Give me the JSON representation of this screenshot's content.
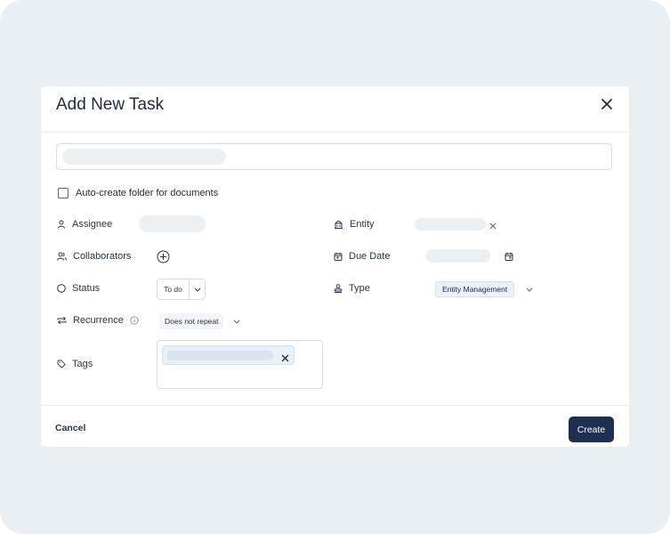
{
  "modal": {
    "title": "Add New Task",
    "task_name_placeholder": ""
  },
  "auto_folder": {
    "label": "Auto-create folder for documents",
    "checked": false
  },
  "fields": {
    "assignee_label": "Assignee",
    "collaborators_label": "Collaborators",
    "status_label": "Status",
    "status_value": "To do",
    "recurrence_label": "Recurrence",
    "recurrence_value": "Does not repeat",
    "tags_label": "Tags",
    "entity_label": "Entity",
    "due_date_label": "Due Date",
    "type_label": "Type",
    "type_value": "Entity Management"
  },
  "footer": {
    "cancel_label": "Cancel",
    "create_label": "Create"
  },
  "colors": {
    "backdrop": "#eaeff4",
    "primary_button": "#1f2f52",
    "type_chip": "#eaf1fb"
  },
  "icons": {
    "close": "close-icon",
    "assignee": "person-icon",
    "collaborators": "people-icon",
    "status": "circle-icon",
    "recurrence": "repeat-icon",
    "info": "info-icon",
    "tags": "tag-icon",
    "entity": "building-icon",
    "due_date": "calendar-icon",
    "type": "stamp-icon"
  }
}
